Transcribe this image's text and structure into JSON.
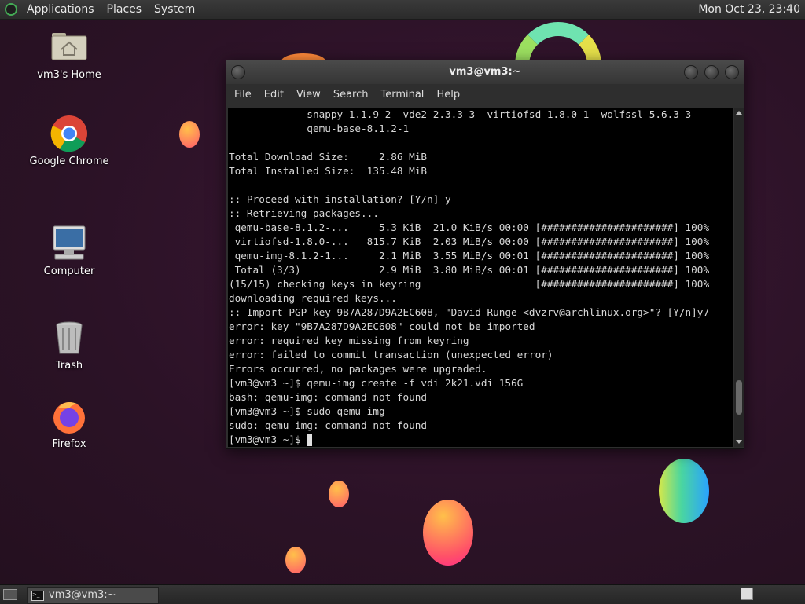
{
  "top_panel": {
    "menus": [
      "Applications",
      "Places",
      "System"
    ],
    "clock": "Mon Oct 23, 23:40"
  },
  "desktop_icons": [
    {
      "label": "vm3's Home",
      "icon": "home-folder-icon"
    },
    {
      "label": "Google Chrome",
      "icon": "chrome-icon"
    },
    {
      "label": "Computer",
      "icon": "computer-icon"
    },
    {
      "label": "Trash",
      "icon": "trash-icon"
    },
    {
      "label": "Firefox",
      "icon": "firefox-icon"
    }
  ],
  "terminal": {
    "title": "vm3@vm3:~",
    "menus": [
      "File",
      "Edit",
      "View",
      "Search",
      "Terminal",
      "Help"
    ],
    "lines": [
      "             snappy-1.1.9-2  vde2-2.3.3-3  virtiofsd-1.8.0-1  wolfssl-5.6.3-3",
      "             qemu-base-8.1.2-1",
      "",
      "Total Download Size:     2.86 MiB",
      "Total Installed Size:  135.48 MiB",
      "",
      ":: Proceed with installation? [Y/n] y",
      ":: Retrieving packages...",
      " qemu-base-8.1.2-...     5.3 KiB  21.0 KiB/s 00:00 [######################] 100%",
      " virtiofsd-1.8.0-...   815.7 KiB  2.03 MiB/s 00:00 [######################] 100%",
      " qemu-img-8.1.2-1...     2.1 MiB  3.55 MiB/s 00:01 [######################] 100%",
      " Total (3/3)             2.9 MiB  3.80 MiB/s 00:01 [######################] 100%",
      "(15/15) checking keys in keyring                   [######################] 100%",
      "downloading required keys...",
      ":: Import PGP key 9B7A287D9A2EC608, \"David Runge <dvzrv@archlinux.org>\"? [Y/n]y7",
      "error: key \"9B7A287D9A2EC608\" could not be imported",
      "error: required key missing from keyring",
      "error: failed to commit transaction (unexpected error)",
      "Errors occurred, no packages were upgraded.",
      "[vm3@vm3 ~]$ qemu-img create -f vdi 2k21.vdi 156G",
      "bash: qemu-img: command not found",
      "[vm3@vm3 ~]$ sudo qemu-img",
      "sudo: qemu-img: command not found",
      "[vm3@vm3 ~]$ "
    ],
    "scroll_position": 0.92
  },
  "taskbar": {
    "task_label": "vm3@vm3:~"
  },
  "colors": {
    "wallpaper": "#2b1226",
    "terminal_bg": "#000000",
    "terminal_fg": "#d8d8d8"
  }
}
